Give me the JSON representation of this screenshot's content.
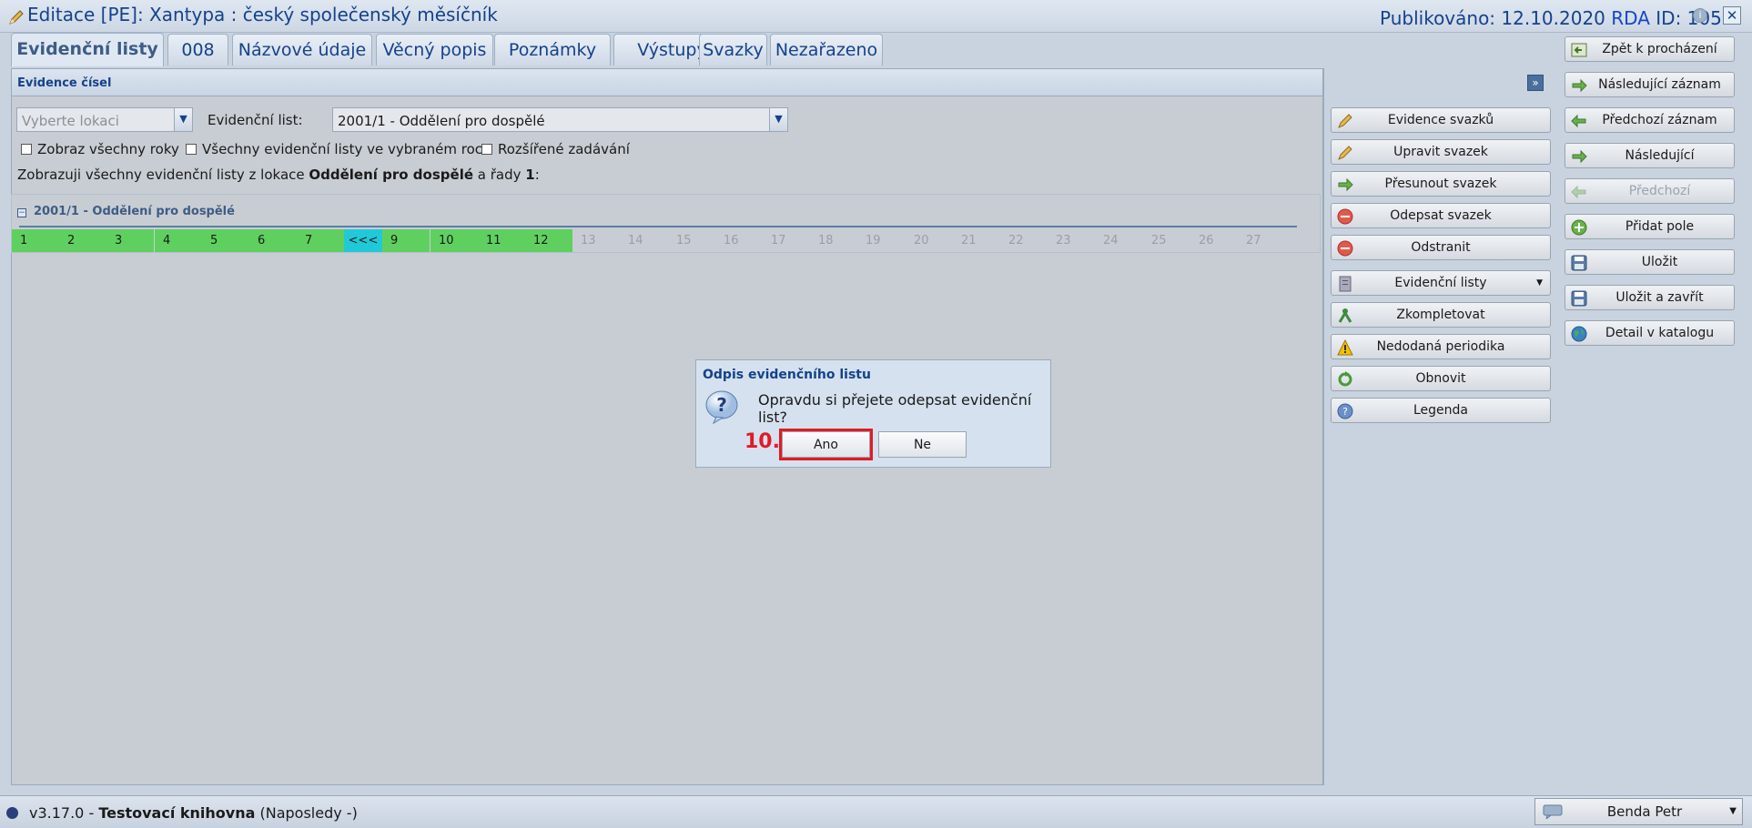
{
  "window": {
    "title": "Editace [PE]: Xantypa : český společenský měsíčník",
    "published": "Publikováno: 12.10.2020",
    "rda": "RDA",
    "record_id": "ID: 1052"
  },
  "tabs": [
    "Evidenční listy",
    "008",
    "Názvové údaje",
    "Věcný popis",
    "Poznámky",
    "Výstupy",
    "Svazky",
    "Nezařazeno"
  ],
  "panel": {
    "title": "Evidence čísel",
    "location_placeholder": "Vyberte lokaci",
    "list_label": "Evidenční list:",
    "list_value": "2001/1 - Oddělení pro dospělé",
    "checkboxes": [
      "Zobraz všechny roky",
      "Všechny evidenční listy ve vybraném roce",
      "Rozšířené zadávání"
    ],
    "info_pre": "Zobrazuji všechny evidenční listy z lokace ",
    "info_location": "Oddělení pro dospělé",
    "info_mid": " a řady ",
    "info_series": "1",
    "info_end": ":",
    "group_title": "2001/1 - Oddělení pro dospělé",
    "issues": [
      {
        "label": "1",
        "state": "received"
      },
      {
        "label": "2",
        "state": "received"
      },
      {
        "label": "3",
        "state": "received"
      },
      {
        "label": "4",
        "state": "received"
      },
      {
        "label": "5",
        "state": "received"
      },
      {
        "label": "6",
        "state": "received"
      },
      {
        "label": "7",
        "state": "received"
      },
      {
        "label": "<<<",
        "state": "current"
      },
      {
        "label": "9",
        "state": "received"
      },
      {
        "label": "10",
        "state": "received"
      },
      {
        "label": "11",
        "state": "received"
      },
      {
        "label": "12",
        "state": "received"
      },
      {
        "label": "13",
        "state": "empty"
      },
      {
        "label": "14",
        "state": "empty"
      },
      {
        "label": "15",
        "state": "empty"
      },
      {
        "label": "16",
        "state": "empty"
      },
      {
        "label": "17",
        "state": "empty"
      },
      {
        "label": "18",
        "state": "empty"
      },
      {
        "label": "19",
        "state": "empty"
      },
      {
        "label": "20",
        "state": "empty"
      },
      {
        "label": "21",
        "state": "empty"
      },
      {
        "label": "22",
        "state": "empty"
      },
      {
        "label": "23",
        "state": "empty"
      },
      {
        "label": "24",
        "state": "empty"
      },
      {
        "label": "25",
        "state": "empty"
      },
      {
        "label": "26",
        "state": "empty"
      },
      {
        "label": "27",
        "state": "empty"
      }
    ]
  },
  "actions": [
    {
      "label": "Evidence svazků",
      "icon": "pencil-icon"
    },
    {
      "label": "Upravit svazek",
      "icon": "pencil-icon"
    },
    {
      "label": "Přesunout svazek",
      "icon": "arrow-right-icon"
    },
    {
      "label": "Odepsat svazek",
      "icon": "minus-circle-icon"
    },
    {
      "label": "Odstranit",
      "icon": "minus-circle-icon"
    },
    {
      "label": "Evidenční listy",
      "icon": "document-icon"
    },
    {
      "label": "Zkompletovat",
      "icon": "merge-icon"
    },
    {
      "label": "Nedodaná periodika",
      "icon": "warning-icon"
    },
    {
      "label": "Obnovit",
      "icon": "refresh-icon"
    },
    {
      "label": "Legenda",
      "icon": "help-icon"
    }
  ],
  "nav_buttons": [
    {
      "label": "Zpět k procházení",
      "icon": "back-icon",
      "disabled": false
    },
    {
      "label": "Následující záznam",
      "icon": "arrow-right-icon",
      "disabled": false
    },
    {
      "label": "Předchozí záznam",
      "icon": "arrow-left-icon",
      "disabled": false
    },
    {
      "label": "Následující",
      "icon": "arrow-right-icon",
      "disabled": false
    },
    {
      "label": "Předchozí",
      "icon": "arrow-left-icon",
      "disabled": true
    },
    {
      "label": "Přidat pole",
      "icon": "plus-circle-icon",
      "disabled": false
    },
    {
      "label": "Uložit",
      "icon": "floppy-icon",
      "disabled": false
    },
    {
      "label": "Uložit a zavřít",
      "icon": "floppy-icon",
      "disabled": false
    },
    {
      "label": "Detail v katalogu",
      "icon": "globe-icon",
      "disabled": false
    }
  ],
  "dialog": {
    "title": "Odpis evidenčního listu",
    "message": "Opravdu si přejete odepsat evidenční list?",
    "yes": "Ano",
    "no": "Ne",
    "step_marker": "10."
  },
  "status": {
    "version": "v3.17.0 - ",
    "library": "Testovací knihovna",
    "last": " (Naposledy -)",
    "user": "Benda Petr"
  },
  "colors": {
    "received": "#5fd05f",
    "current": "#20c9d7",
    "accent": "#15428b",
    "highlight": "#e11b24"
  }
}
